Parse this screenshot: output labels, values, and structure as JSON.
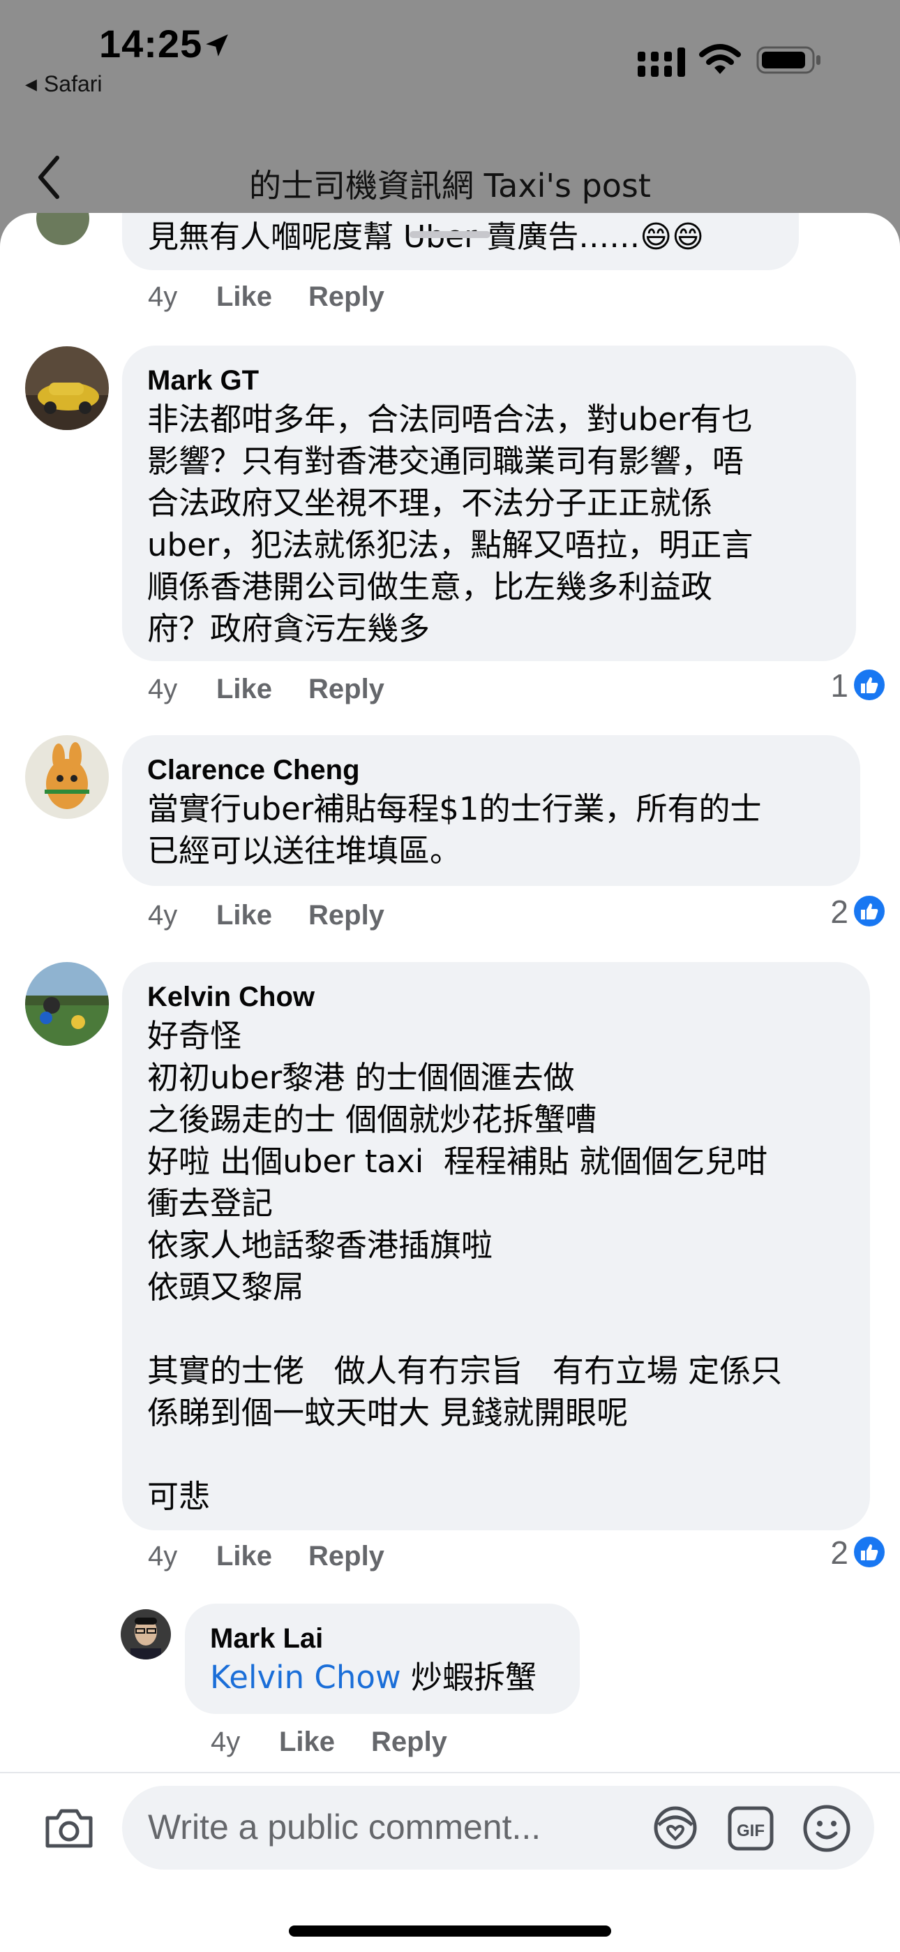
{
  "status_bar": {
    "time": "14:25",
    "back_app": "Safari"
  },
  "header": {
    "title": "的士司機資訊網 Taxi's post"
  },
  "partial_comment": {
    "text": "見無有人嗰呢度幫 Uber 賣廣告……😄😄",
    "meta": {
      "age": "4y",
      "like": "Like",
      "reply": "Reply"
    }
  },
  "comments": [
    {
      "author": "Mark GT",
      "text": "非法都咁多年，合法同唔合法，對uber有乜\n影響？只有對香港交通同職業司有影響，唔\n合法政府又坐視不理，不法分子正正就係\nuber，犯法就係犯法，點解又唔拉，明正言\n順係香港開公司做生意，比左幾多利益政\n府？政府貪污左幾多",
      "age": "4y",
      "like": "Like",
      "reply": "Reply",
      "reactions": "1"
    },
    {
      "author": "Clarence Cheng",
      "text": "當實行uber補貼每程$1的士行業，所有的士\n已經可以送往堆填區。",
      "age": "4y",
      "like": "Like",
      "reply": "Reply",
      "reactions": "2"
    },
    {
      "author": "Kelvin Chow",
      "text": "好奇怪\n初初uber黎港 的士個個滙去做\n之後踢走的士 個個就炒花拆蟹嘈\n好啦 出個uber taxi  程程補貼 就個個乞兒咁\n衝去登記\n依家人地話黎香港插旗啦\n依頭又黎屌\n\n其實的士佬   做人有冇宗旨   有冇立場 定係只\n係睇到個一蚊天咁大 見錢就開眼呢\n\n可悲",
      "age": "4y",
      "like": "Like",
      "reply": "Reply",
      "reactions": "2"
    }
  ],
  "reply": {
    "author": "Mark Lai",
    "mention": "Kelvin Chow",
    "text": " 炒蝦拆蟹",
    "age": "4y",
    "like": "Like",
    "reply": "Reply"
  },
  "composer": {
    "placeholder": "Write a public comment...",
    "icons": [
      "camera-icon",
      "avatar-sticker-icon",
      "gif-icon",
      "emoji-icon"
    ]
  },
  "colors": {
    "bubble": "#f0f2f5",
    "secondary_text": "#65676b",
    "link_blue": "#1a6ed8",
    "like_badge": "#1877f2",
    "dimmed_background": "#8e8e8e"
  }
}
